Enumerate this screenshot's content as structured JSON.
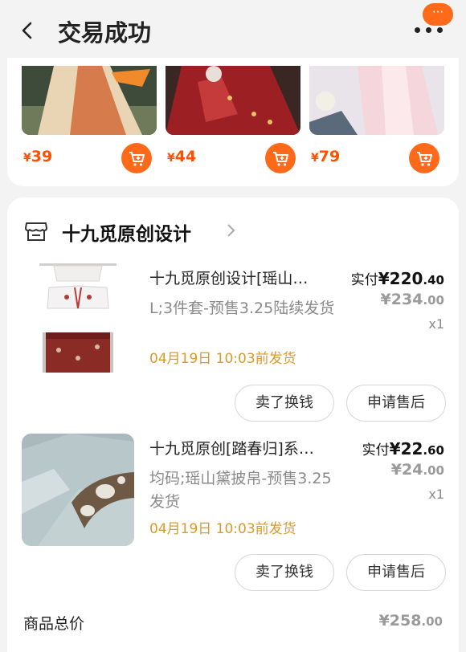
{
  "header": {
    "title": "交易成功",
    "badge_text": "···"
  },
  "recommendations": [
    {
      "currency": "¥",
      "price": "39"
    },
    {
      "currency": "¥",
      "price": "44"
    },
    {
      "currency": "¥",
      "price": "79"
    }
  ],
  "shop": {
    "name": "十九觅原创设计"
  },
  "products": [
    {
      "title": "十九觅原创设计[瑶山…",
      "spec": "L;3件套-预售3.25陆续发货",
      "ship_time": "04月19日 10:03前发货",
      "paid_label": "实付",
      "currency": "¥",
      "paid_int": "220",
      "paid_dec": ".40",
      "orig_int": "234",
      "orig_dec": ".00",
      "qty": "x1",
      "btn_resell": "卖了换钱",
      "btn_aftersale": "申请售后"
    },
    {
      "title": "十九觅原创[踏春归]系…",
      "spec": "均码;瑶山黛披帛-预售3.25发货",
      "ship_time": "04月19日 10:03前发货",
      "paid_label": "实付",
      "currency": "¥",
      "paid_int": "22",
      "paid_dec": ".60",
      "orig_int": "24",
      "orig_dec": ".00",
      "qty": "x1",
      "btn_resell": "卖了换钱",
      "btn_aftersale": "申请售后"
    }
  ],
  "summary": {
    "total_label": "商品总价",
    "currency": "¥",
    "total_int": "258",
    "total_dec": ".00"
  },
  "colors": {
    "accent": "#ff6a1a",
    "price": "#ff5000",
    "ship": "#d99a2a",
    "muted": "#9a9a9a"
  }
}
